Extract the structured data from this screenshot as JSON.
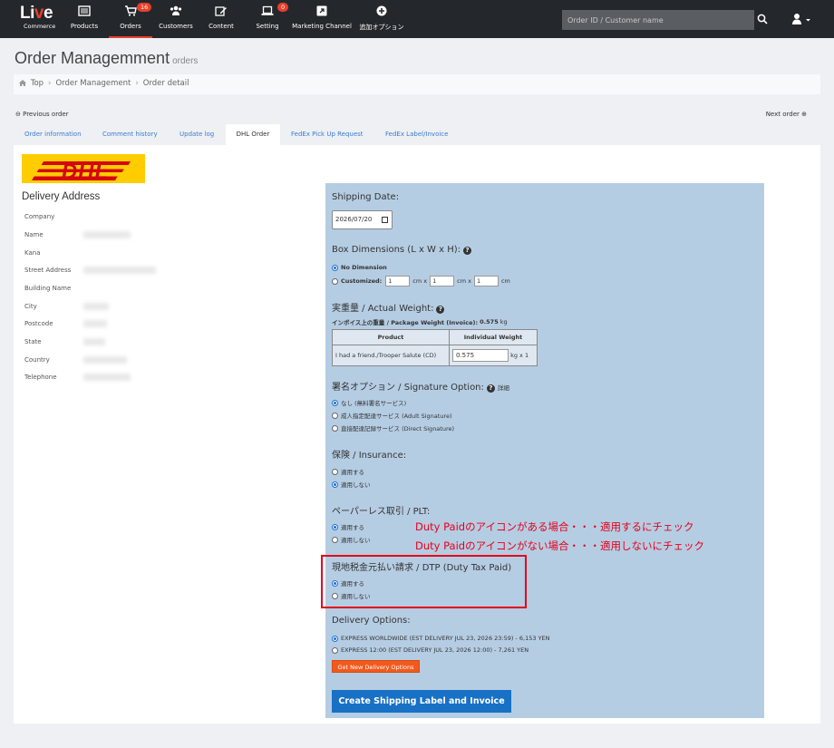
{
  "logo": {
    "line1_a": "Li",
    "line1_b": "v",
    "line1_c": "e",
    "line2": "Commerce"
  },
  "nav": {
    "products": "Products",
    "orders": "Orders",
    "orders_badge": "16",
    "customers": "Customers",
    "content": "Content",
    "setting": "Setting",
    "setting_badge": "0",
    "marketing": "Marketing Channel",
    "addon": "追加オプション",
    "search_placeholder": "Order ID / Customer name"
  },
  "header": {
    "title": "Order Managemment",
    "subtitle": "orders"
  },
  "breadcrumb": [
    "Top",
    "Order Management",
    "Order detail"
  ],
  "pager": {
    "prev": "Previous order",
    "next": "Next order"
  },
  "tabs": [
    "Order information",
    "Comment history",
    "Update log",
    "DHL Order",
    "FedEx Pick Up Request",
    "FedEx Label/Invoice"
  ],
  "delivery": {
    "title": "Delivery Address",
    "fields": [
      "Company",
      "Name",
      "Kana",
      "Street Address",
      "Building Name",
      "City",
      "Postcode",
      "State",
      "Country",
      "Telephone"
    ]
  },
  "form": {
    "shipping_date_title": "Shipping Date:",
    "shipping_date_value": "2026/07/20",
    "box_title": "Box Dimensions (L x W x H):",
    "no_dimension": "No Dimension",
    "customized": "Customized:",
    "dim_l": "1",
    "dim_w": "1",
    "dim_h": "1",
    "unit_cm_x": "cm x",
    "unit_cm": "cm",
    "weight_title": "実重量 / Actual Weight:",
    "invoice_weight_label": "インボイス上の重量 / Package Weight (Invoice):",
    "invoice_weight_value": "0.575",
    "invoice_weight_unit": "kg",
    "table_product": "Product",
    "table_weight": "Individual Weight",
    "product_name": "I had a friend./Trooper Salute (CD)",
    "product_weight": "0.575",
    "weight_suffix": "kg x 1",
    "signature_title": "署名オプション / Signature Option:",
    "signature_detail": "詳細",
    "sig_options": [
      "なし (無料署名サービス)",
      "成人指定配達サービス (Adult Signature)",
      "直接配達記録サービス (Direct Signature)"
    ],
    "insurance_title": "保険 / Insurance:",
    "insurance_options": [
      "適用する",
      "適用しない"
    ],
    "plt_title": "ペーパーレス取引 / PLT:",
    "plt_options": [
      "適用する",
      "適用しない"
    ],
    "dtp_title": "現地税金元払い請求 / DTP (Duty Tax Paid)",
    "dtp_options": [
      "適用する",
      "適用しない"
    ],
    "delivery_title": "Delivery Options:",
    "delivery_options": [
      "EXPRESS WORLDWIDE (EST DELIVERY JUL 23, 2026 23:59) - 6,153 YEN",
      "EXPRESS 12:00 (EST DELIVERY JUL 23, 2026 12:00) - 7,261 YEN"
    ],
    "get_options_btn": "Get New Delivery Options",
    "create_label_btn": "Create Shipping Label and Invoice"
  },
  "annotations": {
    "line1": "Duty Paidのアイコンがある場合・・・適用するにチェック",
    "line2": "Duty Paidのアイコンがない場合・・・適用しないにチェック"
  },
  "colors": {
    "accent_red": "#e8402b",
    "panel_blue": "#b5cde3",
    "primary_blue": "#1871c5",
    "orange": "#f25a1d",
    "annotation_red": "#e4001b",
    "dhl_yellow": "#ffcc00",
    "dhl_red": "#d40511"
  }
}
